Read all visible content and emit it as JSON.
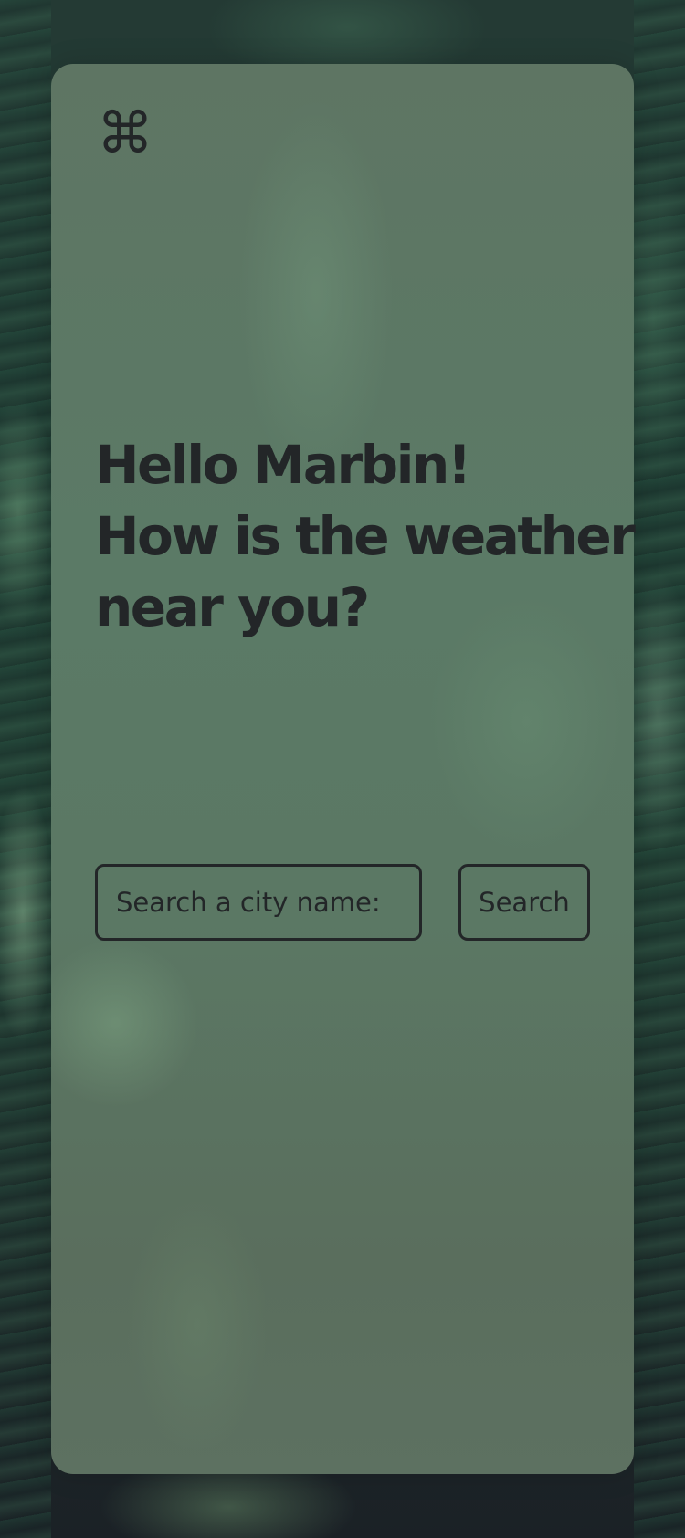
{
  "app": {
    "logo_icon": "command-icon",
    "logo_glyph": "⌘"
  },
  "greeting": {
    "line1": "Hello Marbin!",
    "line2": "How is the weather",
    "line3": "near you?"
  },
  "search": {
    "placeholder": "Search a city name:",
    "value": "",
    "button_label": "Search"
  },
  "colors": {
    "text": "#232628",
    "card": "#5b7864",
    "background": "#1f3a32"
  }
}
